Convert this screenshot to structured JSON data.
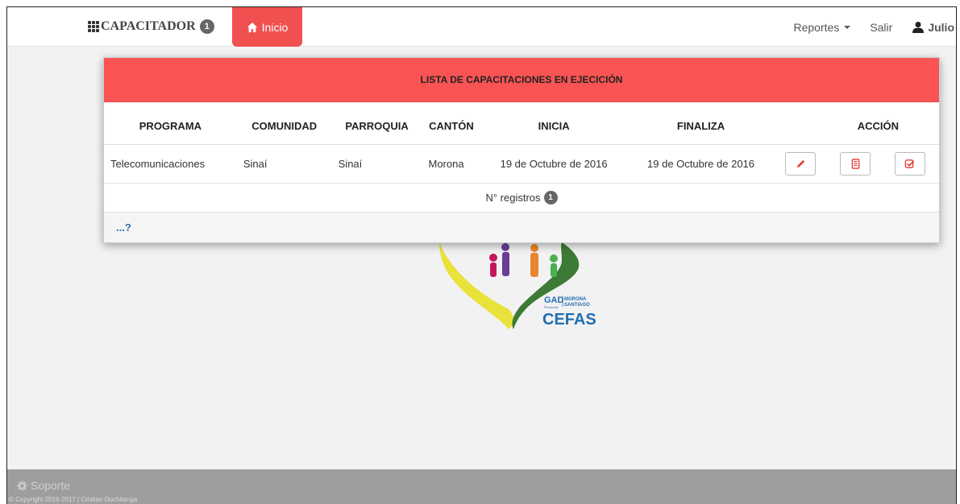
{
  "navbar": {
    "brand": "CAPACITADOR",
    "brand_badge": "1",
    "home_label": "Inicio",
    "reports_label": "Reportes",
    "logout_label": "Salir",
    "user_name": "Julio"
  },
  "panel": {
    "title": "LISTA DE CAPACITACIONES EN EJECICIÓN",
    "columns": [
      "PROGRAMA",
      "COMUNIDAD",
      "PARROQUIA",
      "CANTÓN",
      "INICIA",
      "FINALIZA",
      "ACCIÓN"
    ],
    "rows": [
      {
        "programa": "Telecomunicaciones",
        "comunidad": "Sinaí",
        "parroquia": "Sinaí",
        "canton": "Morona",
        "inicia": "19 de Octubre de 2016",
        "finaliza": "19 de Octubre de 2016"
      }
    ],
    "count_label": "N° registros",
    "count_value": "1",
    "help_link": "...?"
  },
  "logo": {
    "org_left": "GAD",
    "org_left_sub": "Provincial",
    "org_right_1": "MORONA",
    "org_right_2": "SANTIAGO",
    "name": "CEFAS"
  },
  "footer": {
    "support_label": "Soporte",
    "copyright": "© Copyright 2016-2017 | Cristian Duchitanga"
  },
  "colors": {
    "accent": "#f95353",
    "footer": "#9e9e9e",
    "link": "#2b6cb0"
  }
}
